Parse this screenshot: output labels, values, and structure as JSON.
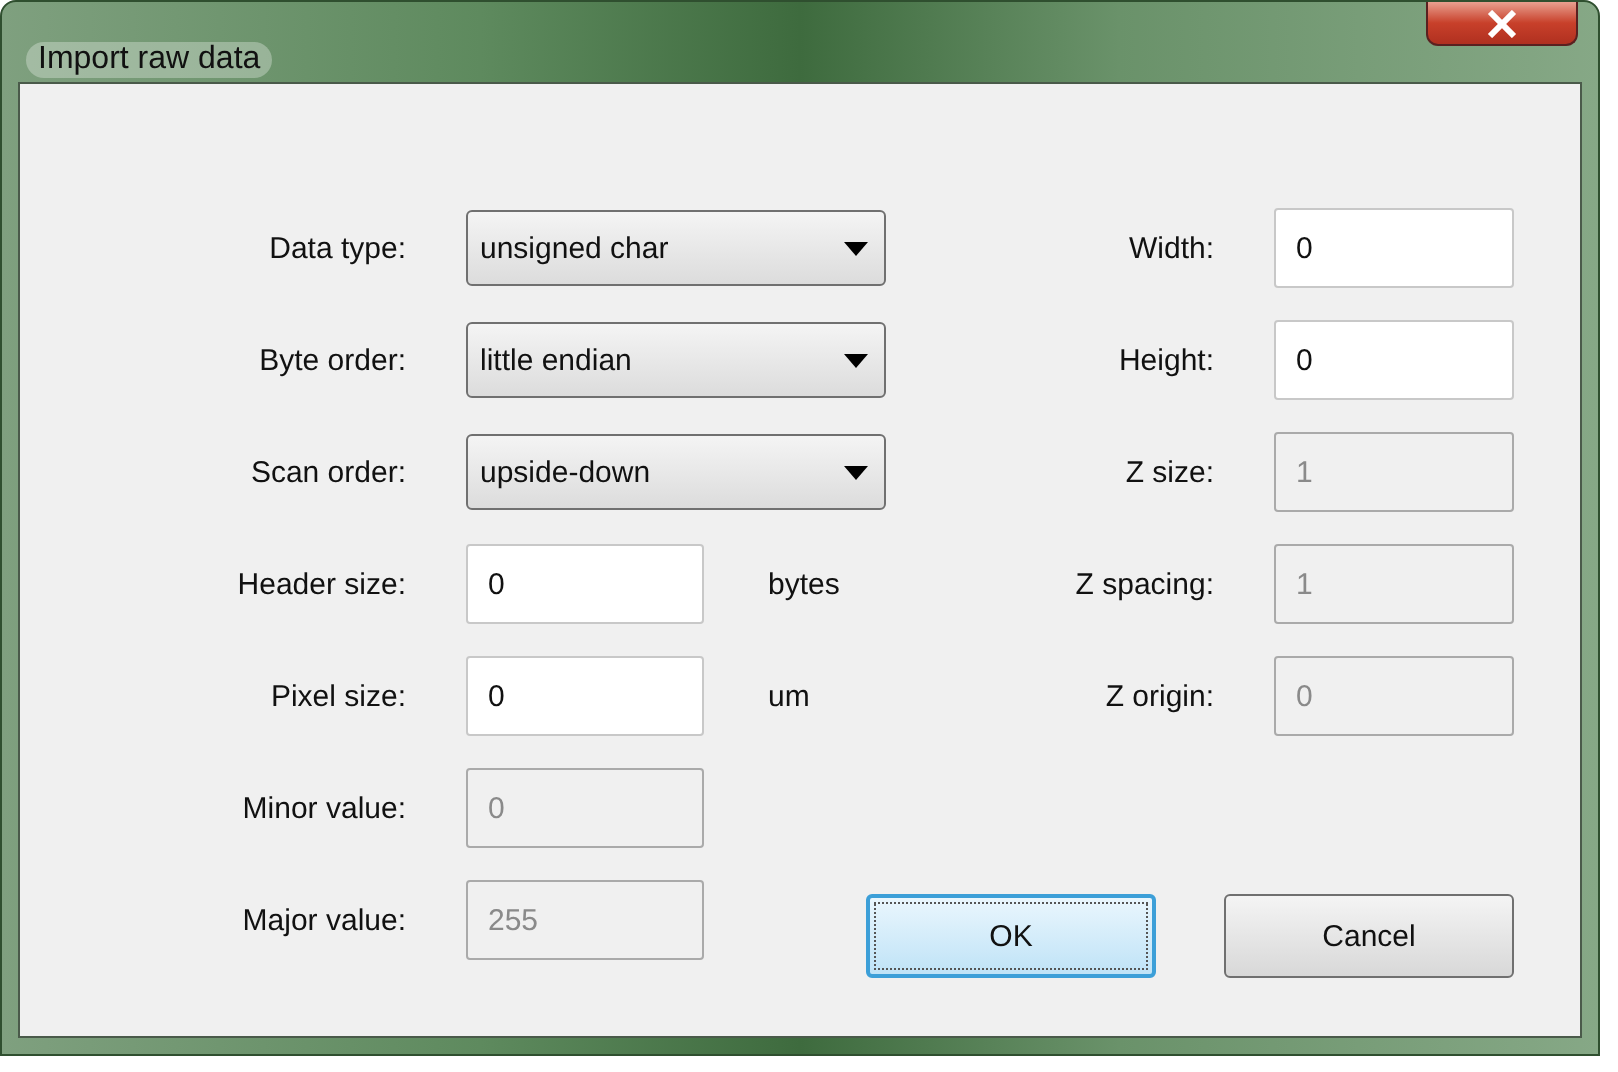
{
  "window": {
    "title": "Import raw data"
  },
  "left_fields": [
    {
      "label": "Data type:",
      "kind": "dropdown",
      "value": "unsigned char",
      "disabled": false
    },
    {
      "label": "Byte order:",
      "kind": "dropdown",
      "value": "little endian",
      "disabled": false
    },
    {
      "label": "Scan order:",
      "kind": "dropdown",
      "value": "upside-down",
      "disabled": false
    },
    {
      "label": "Header size:",
      "kind": "input",
      "value": "0",
      "disabled": false,
      "unit": "bytes"
    },
    {
      "label": "Pixel size:",
      "kind": "input",
      "value": "0",
      "disabled": false,
      "unit": "um"
    },
    {
      "label": "Minor value:",
      "kind": "input",
      "value": "0",
      "disabled": true
    },
    {
      "label": "Major value:",
      "kind": "input",
      "value": "255",
      "disabled": true
    }
  ],
  "right_fields": [
    {
      "label": "Width:",
      "kind": "input",
      "value": "0",
      "disabled": false
    },
    {
      "label": "Height:",
      "kind": "input",
      "value": "0",
      "disabled": false
    },
    {
      "label": "Z size:",
      "kind": "input",
      "value": "1",
      "disabled": true
    },
    {
      "label": "Z spacing:",
      "kind": "input",
      "value": "1",
      "disabled": true
    },
    {
      "label": "Z origin:",
      "kind": "input",
      "value": "0",
      "disabled": true
    }
  ],
  "buttons": [
    {
      "label": "OK",
      "default": true
    },
    {
      "label": "Cancel",
      "default": false
    }
  ]
}
